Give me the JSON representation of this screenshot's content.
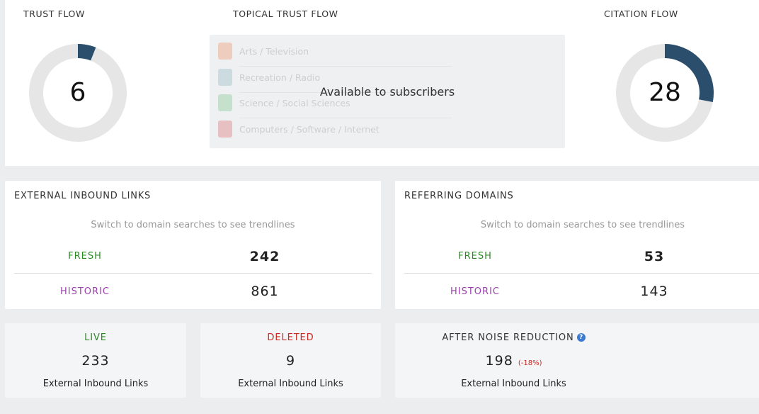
{
  "trust_flow": {
    "title": "TRUST FLOW",
    "value": "6",
    "fraction": 0.06,
    "color": "#2a4e6c"
  },
  "topical_trust_flow": {
    "title": "TOPICAL TRUST FLOW",
    "overlay": "Available to subscribers",
    "topics": [
      {
        "label": "Arts / Television",
        "color": "#e8763a"
      },
      {
        "label": "Recreation / Radio",
        "color": "#6fa7b6"
      },
      {
        "label": "Science / Social Sciences",
        "color": "#5cbd78"
      },
      {
        "label": "Computers / Software / Internet",
        "color": "#d2474a"
      }
    ]
  },
  "citation_flow": {
    "title": "CITATION FLOW",
    "value": "28",
    "fraction": 0.28,
    "color": "#2a4e6c"
  },
  "external_inbound_links": {
    "title": "EXTERNAL INBOUND LINKS",
    "hint": "Switch to domain searches to see trendlines",
    "fresh_label": "FRESH",
    "fresh_value": "242",
    "historic_label": "HISTORIC",
    "historic_value": "861"
  },
  "referring_domains": {
    "title": "REFERRING DOMAINS",
    "hint": "Switch to domain searches to see trendlines",
    "fresh_label": "FRESH",
    "fresh_value": "53",
    "historic_label": "HISTORIC",
    "historic_value": "143"
  },
  "live": {
    "label": "LIVE",
    "value": "233",
    "sub": "External Inbound Links"
  },
  "deleted": {
    "label": "DELETED",
    "value": "9",
    "sub": "External Inbound Links"
  },
  "after_noise": {
    "label": "AFTER NOISE REDUCTION",
    "help_icon": "question-circle-icon",
    "value": "198",
    "delta": "(-18%)",
    "sub": "External Inbound Links"
  }
}
